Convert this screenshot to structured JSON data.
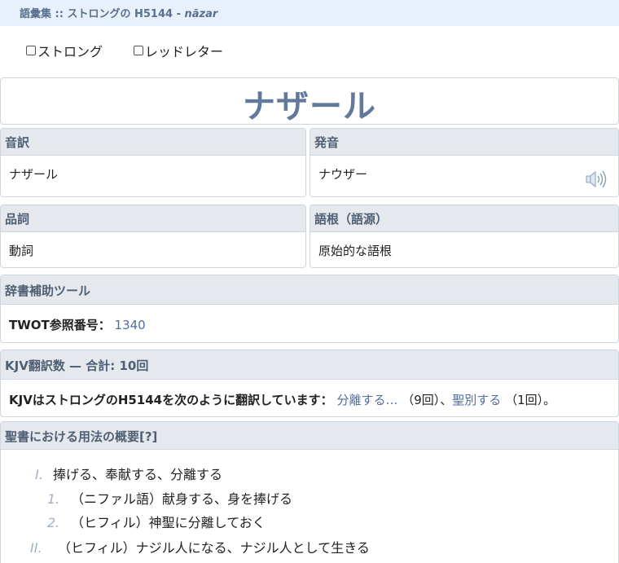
{
  "header": {
    "breadcrumb_prefix": "語彙集 :: ストロングの H5144 - ",
    "breadcrumb_word": "nāzar"
  },
  "toggles": {
    "strong_label": "ストロング",
    "redletter_label": "レッドレター"
  },
  "word": {
    "title": "ナザール"
  },
  "fields": {
    "transliteration_head": "音訳",
    "transliteration_value": "ナザール",
    "pronunciation_head": "発音",
    "pronunciation_value": "ナウザー",
    "pos_head": "品詞",
    "pos_value": "動詞",
    "root_head": "語根（語源）",
    "root_value": "原始的な語根"
  },
  "tools": {
    "head": "辞書補助ツール",
    "twot_label": "TWOT参照番号：",
    "twot_value": "1340"
  },
  "kjv": {
    "head": "KJV翻訳数 — 合計: 10回",
    "intro": "KJVはストロングのH5144を次のように翻訳しています：",
    "item1": "分離する…",
    "count1": "（9回）、",
    "item2": "聖別する",
    "count2": "（1回）。"
  },
  "usage": {
    "head": "聖書における用法の概要[?]",
    "items": [
      {
        "num": "I.",
        "text": "捧げる、奉献する、分離する"
      },
      {
        "num": "1.",
        "text": "（ニファル語）献身する、身を捧げる"
      },
      {
        "num": "2.",
        "text": "（ヒフィル）神聖に分離しておく"
      },
      {
        "num": "II.",
        "text": "（ヒフィル）ナジル人になる、ナジル人として生きる"
      }
    ]
  },
  "icons": {
    "speaker": "speaker-icon",
    "checkbox": "checkbox-icon"
  }
}
